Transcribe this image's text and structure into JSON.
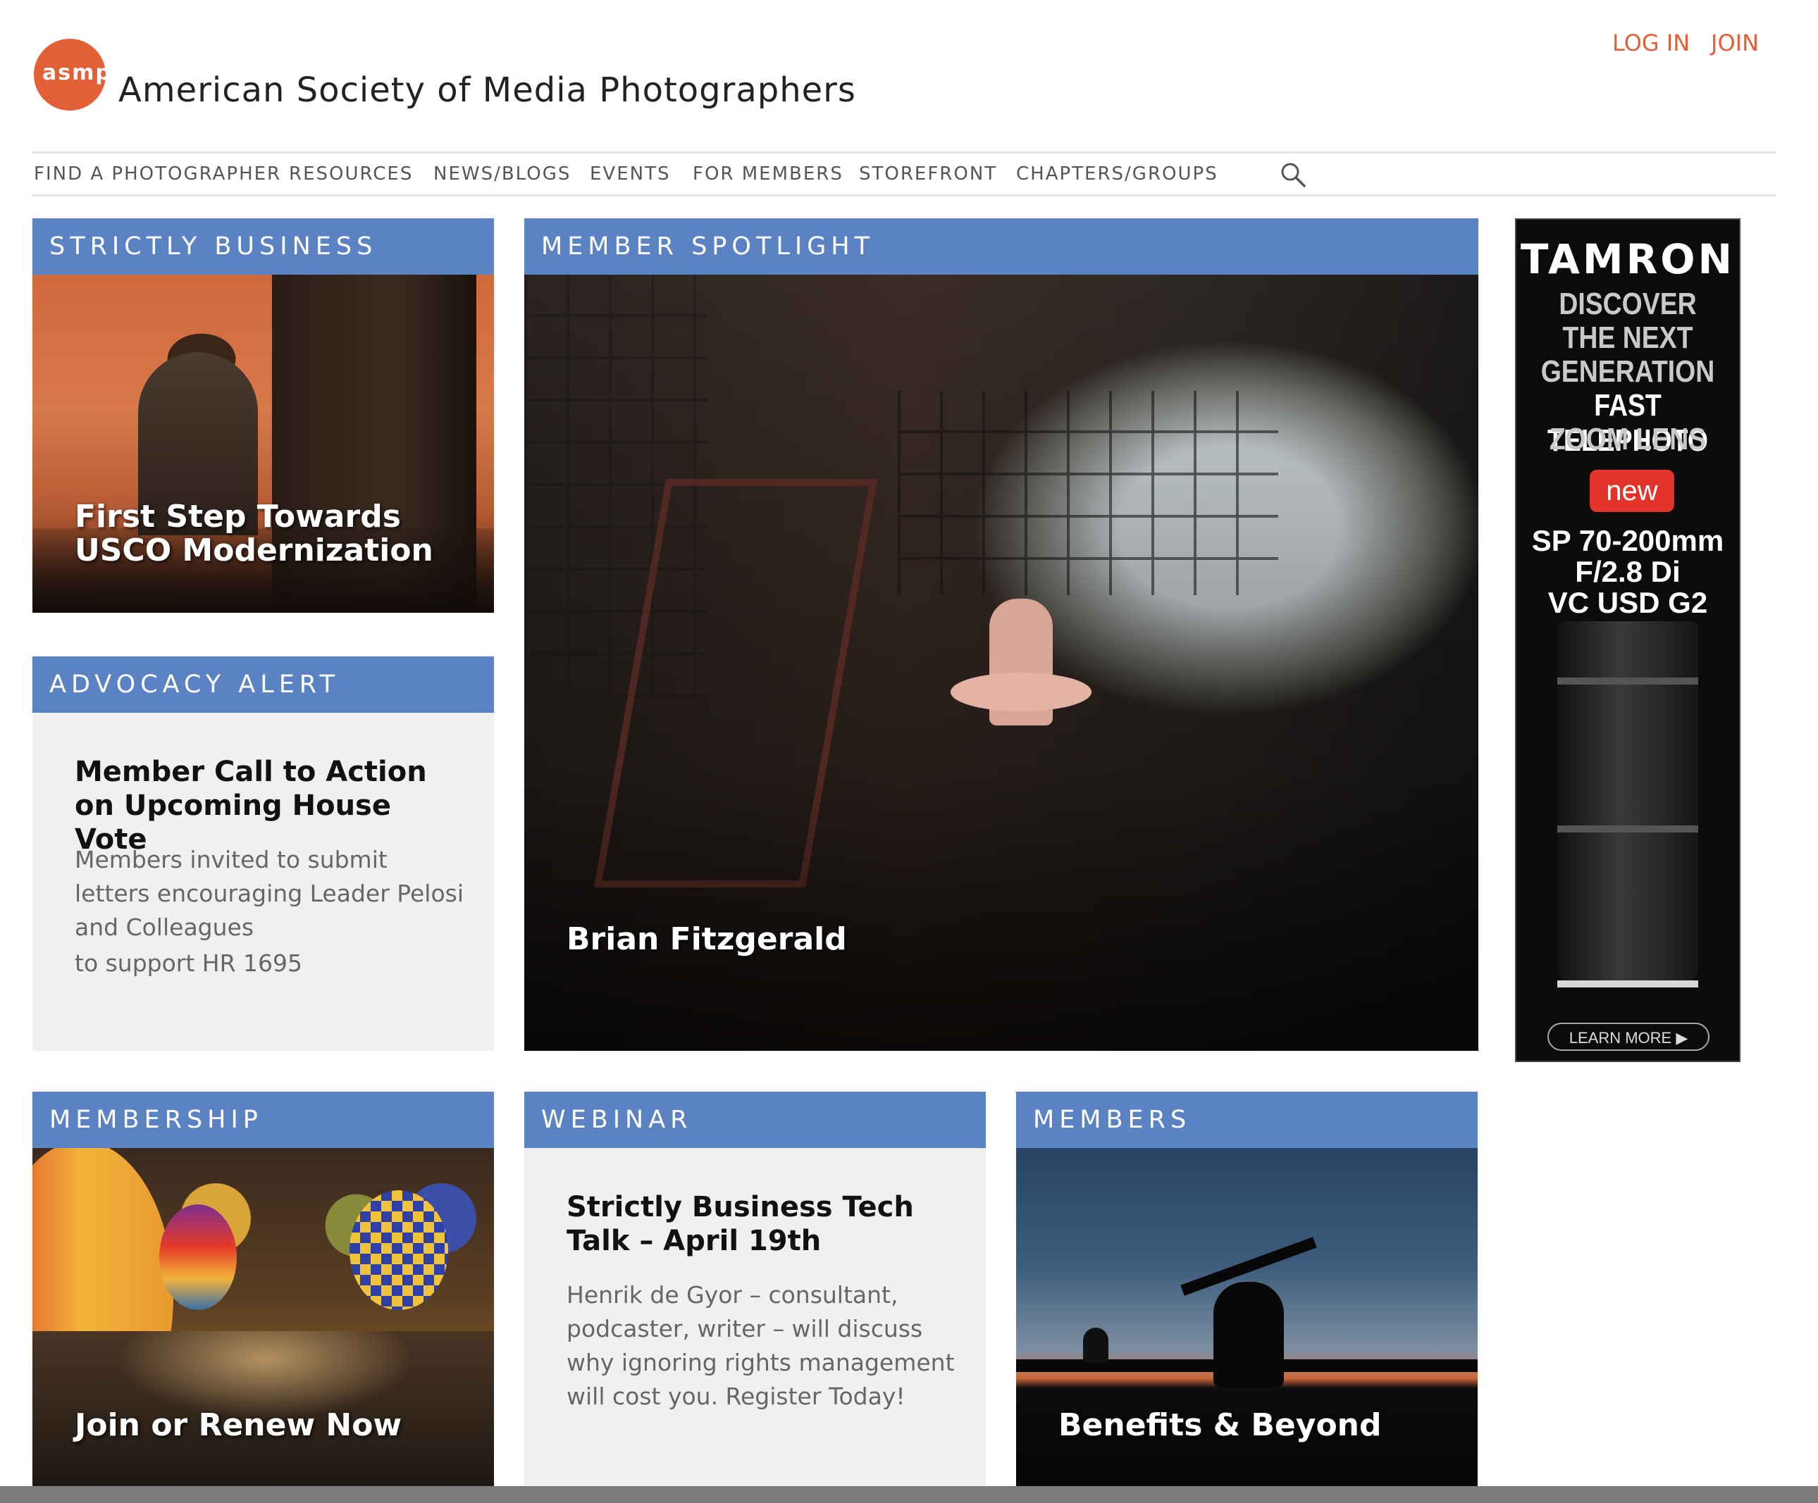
{
  "header": {
    "logo_text": "asmp",
    "site_name": "American Society of Media Photographers",
    "login": "LOG IN",
    "join": "JOIN"
  },
  "nav": {
    "items": [
      "FIND A PHOTOGRAPHER",
      "RESOURCES",
      "NEWS/BLOGS",
      "EVENTS",
      "FOR MEMBERS",
      "STOREFRONT",
      "CHAPTERS/GROUPS"
    ],
    "search_icon": "search-icon"
  },
  "colors": {
    "accent": "#e35f36",
    "panel_header": "#5b82c2",
    "card_bg": "#f0f0f0"
  },
  "panels": {
    "strictly_business": {
      "header": "STRICTLY BUSINESS",
      "title": "First Step Towards USCO Modernization"
    },
    "advocacy": {
      "header": "ADVOCACY ALERT",
      "title": "Member Call to Action on Upcoming House Vote",
      "body": "Members invited to submit letters encouraging Leader Pelosi and Colleagues",
      "body2": "to support HR 1695"
    },
    "spotlight": {
      "header": "MEMBER SPOTLIGHT",
      "name": "Brian Fitzgerald"
    },
    "membership": {
      "header": "MEMBERSHIP",
      "title": "Join or Renew Now"
    },
    "webinar": {
      "header": "WEBINAR",
      "title": "Strictly Business Tech Talk – April 19th",
      "body": "Henrik de Gyor – consultant, podcaster, writer – will discuss why ignoring rights management will cost you. Register Today!"
    },
    "members": {
      "header": "MEMBERS",
      "title": "Benefits & Beyond"
    }
  },
  "ad": {
    "brand": "TAMRON",
    "lines": [
      "DISCOVER",
      "THE NEXT",
      "GENERATION",
      "FAST TELEPHOTO",
      "ZOOM LENS"
    ],
    "badge": "new",
    "model": [
      "SP 70-200mm",
      "F/2.8 Di",
      "VC USD G2"
    ],
    "cta": "LEARN MORE ▶"
  }
}
